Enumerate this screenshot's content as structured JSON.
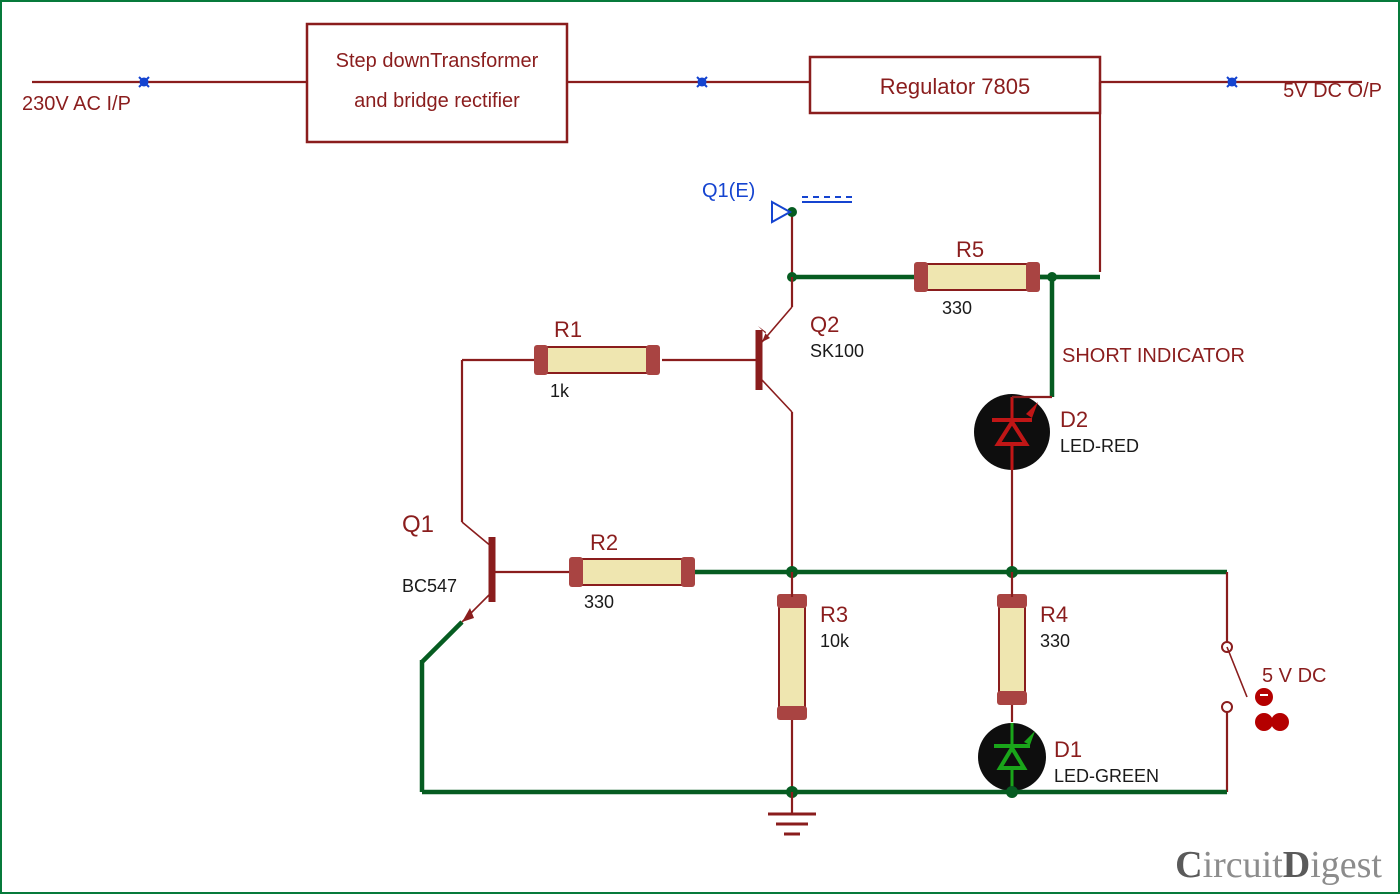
{
  "io": {
    "input_label": "230V AC I/P",
    "output_label": "5V DC O/P",
    "supply_right_label": "5 V DC"
  },
  "blocks": {
    "transformer_line1": "Step downTransformer",
    "transformer_line2": "and bridge rectifier",
    "regulator_label": "Regulator  7805"
  },
  "probe": {
    "label": "Q1(E)"
  },
  "components": {
    "Q1": {
      "ref": "Q1",
      "value": "BC547"
    },
    "Q2": {
      "ref": "Q2",
      "value": "SK100"
    },
    "R1": {
      "ref": "R1",
      "value": "1k"
    },
    "R2": {
      "ref": "R2",
      "value": "330"
    },
    "R3": {
      "ref": "R3",
      "value": "10k"
    },
    "R4": {
      "ref": "R4",
      "value": "330"
    },
    "R5": {
      "ref": "R5",
      "value": "330"
    },
    "D1": {
      "ref": "D1",
      "value": "LED-GREEN"
    },
    "D2": {
      "ref": "D2",
      "value": "LED-RED"
    }
  },
  "annotations": {
    "short_indicator": "SHORT INDICATOR"
  },
  "watermark": {
    "part1": "C",
    "part2": "ircuit",
    "part3": "D",
    "part4": "igest"
  }
}
